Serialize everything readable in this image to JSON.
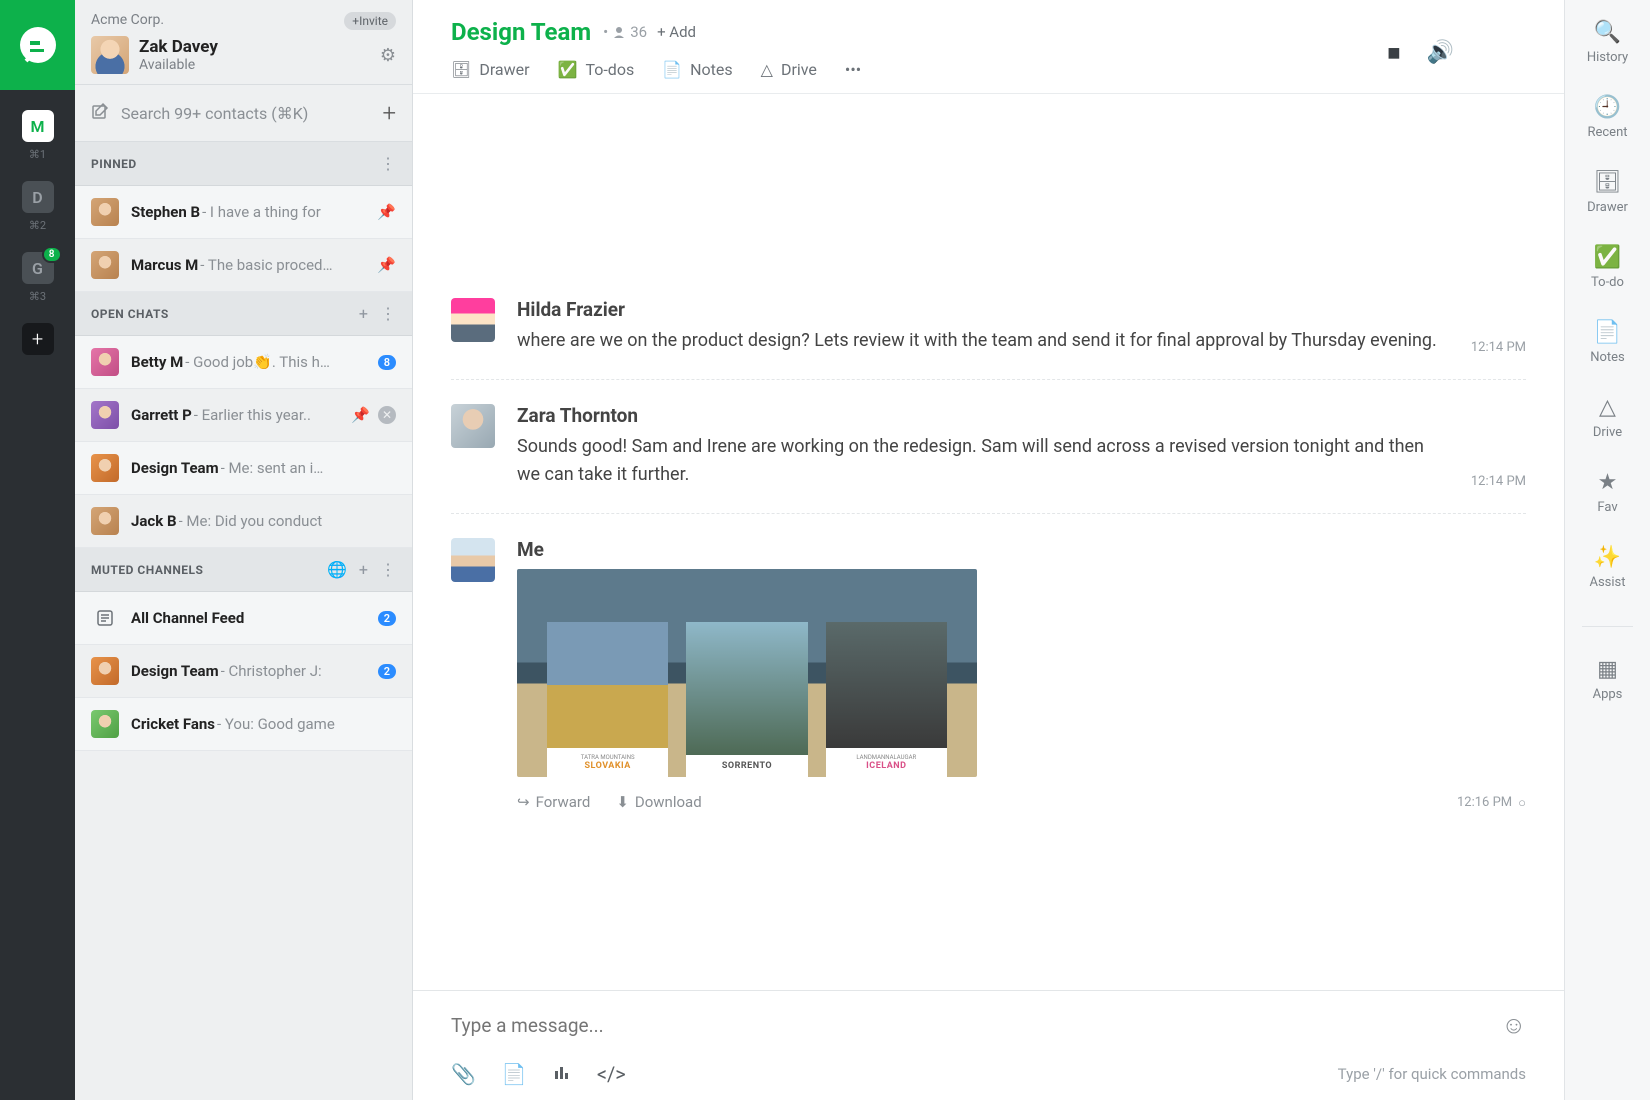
{
  "rail": {
    "items": [
      {
        "label": "M",
        "shortcut": "⌘1",
        "active": true
      },
      {
        "label": "D",
        "shortcut": "⌘2",
        "active": false
      },
      {
        "label": "G",
        "shortcut": "⌘3",
        "active": false,
        "badge": "8"
      }
    ]
  },
  "sidebar": {
    "org": "Acme Corp.",
    "invite": "+Invite",
    "user": {
      "name": "Zak Davey",
      "status": "Available"
    },
    "search_placeholder": "Search 99+ contacts (⌘K)",
    "sections": {
      "pinned": {
        "title": "PINNED",
        "items": [
          {
            "name": "Stephen B",
            "preview": " - I have a thing for"
          },
          {
            "name": "Marcus M",
            "preview": " - The basic proced…"
          }
        ]
      },
      "open": {
        "title": "OPEN CHATS",
        "items": [
          {
            "name": "Betty M",
            "preview": " - Good job👏. This h…",
            "badge": "8"
          },
          {
            "name": "Garrett P",
            "preview": " - Earlier this year.."
          },
          {
            "name": "Design Team",
            "preview": " - Me: sent an i…"
          },
          {
            "name": "Jack B",
            "preview": "- Me: Did you conduct"
          }
        ]
      },
      "muted": {
        "title": "MUTED CHANNELS",
        "items": [
          {
            "name": "All Channel Feed",
            "preview": "",
            "badge": "2"
          },
          {
            "name": "Design Team",
            "preview": " - Christopher J:",
            "badge": "2"
          },
          {
            "name": "Cricket Fans",
            "preview": " - You: Good game"
          }
        ]
      }
    }
  },
  "header": {
    "title": "Design Team",
    "members": "36",
    "add": "+ Add",
    "tools": {
      "drawer": "Drawer",
      "todos": "To-dos",
      "notes": "Notes",
      "drive": "Drive"
    }
  },
  "messages": [
    {
      "author": "Hilda Frazier",
      "text": "where are we on the product design? Lets review it with the team and send it for final approval by Thursday evening.",
      "time": "12:14 PM"
    },
    {
      "author": "Zara Thornton",
      "text": "Sounds good! Sam and Irene are working on the redesign. Sam will send across a revised version tonight and then we can take it further.",
      "time": "12:14 PM"
    },
    {
      "author": "Me",
      "time": "12:16 PM",
      "forward": "Forward",
      "download": "Download",
      "cards": [
        {
          "pre": "TATRA MOUNTAINS",
          "title": "SLOVAKIA"
        },
        {
          "pre": "",
          "title": "SORRENTO"
        },
        {
          "pre": "LANDMANNALAUGAR",
          "title": "ICELAND"
        }
      ]
    }
  ],
  "composer": {
    "placeholder": "Type a message...",
    "hint": "Type '/' for quick commands"
  },
  "rrail": {
    "items": [
      "History",
      "Recent",
      "Drawer",
      "To-do",
      "Notes",
      "Drive",
      "Fav",
      "Assist",
      "Apps"
    ]
  }
}
